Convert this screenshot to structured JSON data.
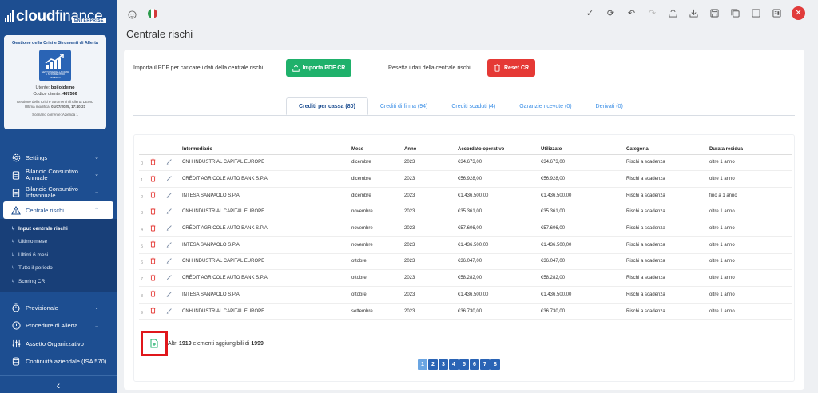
{
  "app": {
    "logo_text_bold": "cloud",
    "logo_text_light": "finance",
    "logo_sub": "ENTERPRISE"
  },
  "card": {
    "title": "Gestione della Crisi e Strumenti di Allerta",
    "image_caption": "GESTIONE DELLA CRISI E STRUMENTI DI ALLERTA",
    "user_label": "Utente:",
    "user_value": "bpilotdemo",
    "code_label": "Codice utente:",
    "code_value": "487566",
    "module_line": "Gestione della Crisi e Strumenti di Allerta DEMO",
    "modified_label": "Ultima modifica:",
    "modified_value": "01/07/2025, 17:40:21",
    "scenario": "Scenario corrente: Azienda 1"
  },
  "nav": {
    "settings": "Settings",
    "bilancio_annuale": "Bilancio Consuntivo Annuale",
    "bilancio_infrannuale": "Bilancio Consuntivo Infrannuale",
    "centrale_rischi": "Centrale rischi",
    "sub": [
      {
        "label": "Input centrale rischi"
      },
      {
        "label": "Ultimo mese"
      },
      {
        "label": "Ultimi 6 mesi"
      },
      {
        "label": "Tutto il periodo"
      },
      {
        "label": "Scoring CR"
      }
    ],
    "previsionale": "Previsionale",
    "procedure": "Procedure di Allerta",
    "assetto": "Assetto Organizzativo",
    "continuita": "Continuità aziendale (ISA 570)",
    "collapse": "‹"
  },
  "page": {
    "title": "Centrale rischi"
  },
  "actions": {
    "import_label": "Importa il PDF per caricare i dati della centrale rischi",
    "import_button": "Importa PDF CR",
    "reset_label": "Resetta i dati della centrale rischi",
    "reset_button": "Reset CR"
  },
  "tabs": [
    {
      "label": "Crediti per cassa (80)"
    },
    {
      "label": "Crediti di firma (94)"
    },
    {
      "label": "Crediti scaduti (4)"
    },
    {
      "label": "Garanzie ricevute (0)"
    },
    {
      "label": "Derivati (0)"
    }
  ],
  "table": {
    "columns": [
      "Intermediario",
      "Mese",
      "Anno",
      "Accordato operativo",
      "Utilizzato",
      "Categoria",
      "Durata residua"
    ],
    "rows": [
      {
        "idx": "0",
        "intermediario": "CNH INDUSTRIAL CAPITAL EUROPE",
        "mese": "dicembre",
        "anno": "2023",
        "accordato": "€34.673,00",
        "utilizzato": "€34.673,00",
        "categoria": "Rischi a scadenza",
        "durata": "oltre 1 anno"
      },
      {
        "idx": "1",
        "intermediario": "CRÉDIT AGRICOLE AUTO BANK S.P.A.",
        "mese": "dicembre",
        "anno": "2023",
        "accordato": "€56.928,00",
        "utilizzato": "€56.928,00",
        "categoria": "Rischi a scadenza",
        "durata": "oltre 1 anno"
      },
      {
        "idx": "2",
        "intermediario": "INTESA SANPAOLO S.P.A.",
        "mese": "dicembre",
        "anno": "2023",
        "accordato": "€1.436.500,00",
        "utilizzato": "€1.436.500,00",
        "categoria": "Rischi a scadenza",
        "durata": "fino a 1 anno"
      },
      {
        "idx": "3",
        "intermediario": "CNH INDUSTRIAL CAPITAL EUROPE",
        "mese": "novembre",
        "anno": "2023",
        "accordato": "€35.361,00",
        "utilizzato": "€35.361,00",
        "categoria": "Rischi a scadenza",
        "durata": "oltre 1 anno"
      },
      {
        "idx": "4",
        "intermediario": "CRÉDIT AGRICOLE AUTO BANK S.P.A.",
        "mese": "novembre",
        "anno": "2023",
        "accordato": "€57.606,00",
        "utilizzato": "€57.606,00",
        "categoria": "Rischi a scadenza",
        "durata": "oltre 1 anno"
      },
      {
        "idx": "5",
        "intermediario": "INTESA SANPAOLO S.P.A.",
        "mese": "novembre",
        "anno": "2023",
        "accordato": "€1.436.500,00",
        "utilizzato": "€1.436.500,00",
        "categoria": "Rischi a scadenza",
        "durata": "oltre 1 anno"
      },
      {
        "idx": "6",
        "intermediario": "CNH INDUSTRIAL CAPITAL EUROPE",
        "mese": "ottobre",
        "anno": "2023",
        "accordato": "€36.047,00",
        "utilizzato": "€36.047,00",
        "categoria": "Rischi a scadenza",
        "durata": "oltre 1 anno"
      },
      {
        "idx": "7",
        "intermediario": "CRÉDIT AGRICOLE AUTO BANK S.P.A.",
        "mese": "ottobre",
        "anno": "2023",
        "accordato": "€58.282,00",
        "utilizzato": "€58.282,00",
        "categoria": "Rischi a scadenza",
        "durata": "oltre 1 anno"
      },
      {
        "idx": "8",
        "intermediario": "INTESA SANPAOLO S.P.A.",
        "mese": "ottobre",
        "anno": "2023",
        "accordato": "€1.436.500,00",
        "utilizzato": "€1.436.500,00",
        "categoria": "Rischi a scadenza",
        "durata": "oltre 1 anno"
      },
      {
        "idx": "9",
        "intermediario": "CNH INDUSTRIAL CAPITAL EUROPE",
        "mese": "settembre",
        "anno": "2023",
        "accordato": "€36.730,00",
        "utilizzato": "€36.730,00",
        "categoria": "Rischi a scadenza",
        "durata": "oltre 1 anno"
      }
    ]
  },
  "footer": {
    "prefix": "Altri",
    "count": "1919",
    "middle": "elementi aggiungibili di",
    "total": "1999"
  },
  "pagination": {
    "pages": [
      "1",
      "2",
      "3",
      "4",
      "5",
      "6",
      "7",
      "8"
    ],
    "current": "1"
  },
  "icons": {
    "topbar": [
      "check-icon",
      "refresh-icon",
      "undo-icon",
      "redo-icon",
      "upload-icon",
      "download-icon",
      "save-icon",
      "copy-icon",
      "columns-icon",
      "report-icon",
      "close-icon"
    ]
  },
  "colors": {
    "sidebar": "#1d4e91",
    "accent": "#3a8ee6",
    "green": "#1fb16b",
    "red": "#e53935",
    "highlight": "#e0161b"
  }
}
